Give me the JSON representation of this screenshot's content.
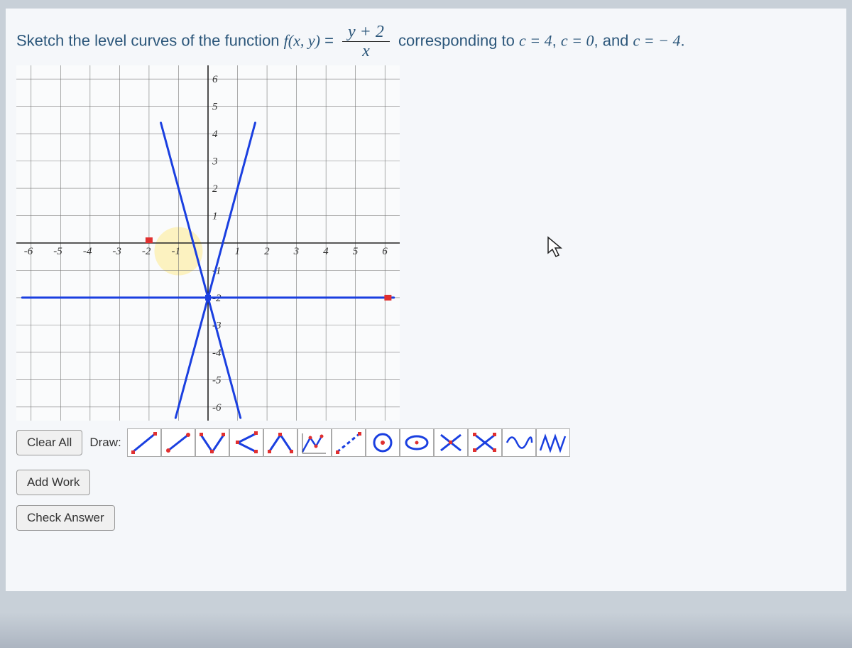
{
  "question": {
    "prefix": "Sketch the level curves of the function ",
    "func": "f(x, y)",
    "eq": " = ",
    "frac_num": "y + 2",
    "frac_den": "x",
    "suffix1": " corresponding to ",
    "c1": "c = 4",
    "sep1": ", ",
    "c2": "c = 0",
    "sep2": ", and ",
    "c3": "c = − 4",
    "period": "."
  },
  "chart_data": {
    "type": "line",
    "xlim": [
      -6.5,
      6.5
    ],
    "ylim": [
      -6.5,
      6.5
    ],
    "x_ticks": [
      -6,
      -5,
      -4,
      -3,
      -2,
      -1,
      1,
      2,
      3,
      4,
      5,
      6
    ],
    "y_ticks": [
      -6,
      -5,
      -4,
      -3,
      -2,
      -1,
      1,
      2,
      3,
      4,
      5,
      6
    ],
    "series": [
      {
        "name": "c=4 right",
        "color": "#1a3fe0",
        "points": [
          [
            0,
            -2
          ],
          [
            1.6,
            4.4
          ]
        ]
      },
      {
        "name": "c=4 left",
        "color": "#1a3fe0",
        "points": [
          [
            0,
            -2
          ],
          [
            -1.1,
            -6.4
          ]
        ]
      },
      {
        "name": "c=-4 right",
        "color": "#1a3fe0",
        "points": [
          [
            0,
            -2
          ],
          [
            1.1,
            -6.4
          ]
        ]
      },
      {
        "name": "c=-4 left",
        "color": "#1a3fe0",
        "points": [
          [
            0,
            -2
          ],
          [
            -1.6,
            4.4
          ]
        ]
      },
      {
        "name": "c=0",
        "color": "#1a3fe0",
        "points": [
          [
            -6.3,
            -2
          ],
          [
            6.3,
            -2
          ]
        ]
      }
    ],
    "markers": [
      {
        "x": 6.1,
        "y": -2,
        "color": "#e03030"
      },
      {
        "x": -2,
        "y": 0.1,
        "color": "#e03030"
      }
    ]
  },
  "toolbar": {
    "clear": "Clear All",
    "draw_label": "Draw:"
  },
  "tools": [
    {
      "name": "line-ne"
    },
    {
      "name": "line-segment"
    },
    {
      "name": "open-up"
    },
    {
      "name": "open-right"
    },
    {
      "name": "open-down"
    },
    {
      "name": "piecewise"
    },
    {
      "name": "dashed-line"
    },
    {
      "name": "circle-dot"
    },
    {
      "name": "ellipse"
    },
    {
      "name": "x-mark"
    },
    {
      "name": "x-box"
    },
    {
      "name": "sine"
    },
    {
      "name": "zigzag"
    }
  ],
  "buttons": {
    "add_work": "Add Work",
    "check": "Check Answer"
  }
}
